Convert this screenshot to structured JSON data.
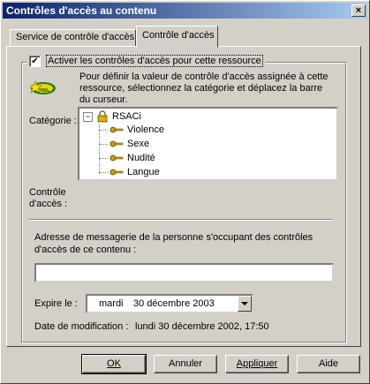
{
  "window": {
    "title": "Contrôles d'accès au contenu",
    "close_glyph": "×"
  },
  "tabs": [
    {
      "label": "Service de contrôle d'accès"
    },
    {
      "label": "Contrôle d'accès"
    }
  ],
  "panel": {
    "enable_checkbox": {
      "checked": true,
      "label": "Activer les contrôles d'accès pour cette ressource"
    },
    "description": "Pour définir la valeur de contrôle d'accès assignée à cette ressource, sélectionnez la catégorie et déplacez la barre du curseur.",
    "category_label": "Catégorie :",
    "tree": {
      "root": {
        "expander": "−",
        "label": "RSACi"
      },
      "children": [
        "Violence",
        "Sexe",
        "Nudité",
        "Langue"
      ]
    },
    "access_control_label": "Contrôle d'accès :",
    "email_label": "Adresse de messagerie de la personne s'occupant des contrôles d'accès de ce contenu :",
    "email_value": "",
    "expires_label": "Expire le :",
    "expires_day": "mardi",
    "expires_date": "30 décembre 2003",
    "modified_label": "Date de modification :",
    "modified_value": "lundi 30 décembre 2002, 17:50"
  },
  "buttons": {
    "ok": "OK",
    "cancel": "Annuler",
    "apply": "Appliquer",
    "help": "Aide"
  }
}
